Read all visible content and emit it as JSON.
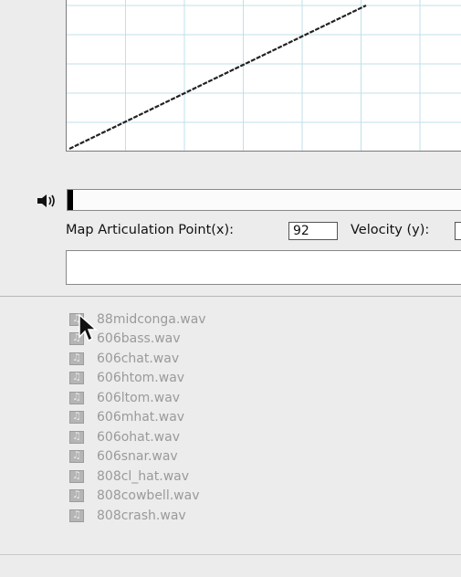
{
  "articulation": {
    "x_label": "Map Articulation Point(x):",
    "x_value": "92",
    "y_label": "Velocity (y):",
    "name_value": ""
  },
  "level_meter": {
    "level": 0.012
  },
  "mapping_curve": {
    "type": "linear",
    "grid": "on",
    "color": "#222222",
    "grid_color": "#bfe0ea"
  },
  "files": [
    {
      "name": "88midconga.wav"
    },
    {
      "name": "606bass.wav"
    },
    {
      "name": "606chat.wav"
    },
    {
      "name": "606htom.wav"
    },
    {
      "name": "606ltom.wav"
    },
    {
      "name": "606mhat.wav"
    },
    {
      "name": "606ohat.wav"
    },
    {
      "name": "606snar.wav"
    },
    {
      "name": "808cl_hat.wav"
    },
    {
      "name": "808cowbell.wav"
    },
    {
      "name": "808crash.wav"
    }
  ]
}
